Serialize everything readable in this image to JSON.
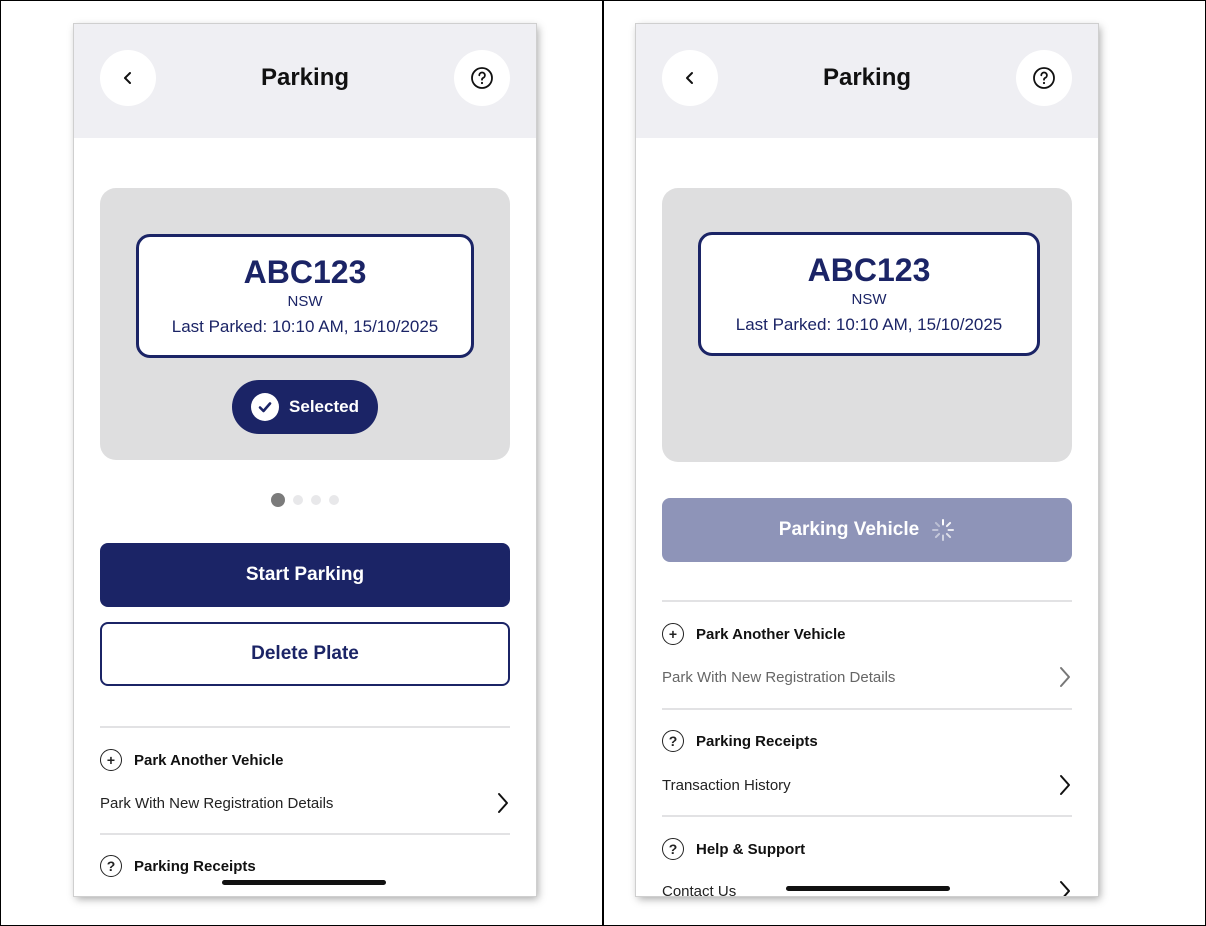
{
  "left_screen": {
    "header": {
      "title": "Parking",
      "back_icon": "chevron-left-icon",
      "help_icon": "question-circle-icon"
    },
    "vehicle_card": {
      "plate_number": "ABC123",
      "state": "NSW",
      "last_parked": "Last Parked: 10:10 AM, 15/10/2025",
      "selected_label": "Selected"
    },
    "pagination": {
      "count": 4,
      "active_index": 0
    },
    "start_parking_label": "Start Parking",
    "delete_plate_label": "Delete Plate",
    "park_another": {
      "title": "Park Another Vehicle",
      "row_label": "Park With New Registration Details"
    },
    "receipts": {
      "title": "Parking Receipts"
    }
  },
  "right_screen": {
    "header": {
      "title": "Parking",
      "back_icon": "chevron-left-icon",
      "help_icon": "question-circle-icon"
    },
    "vehicle_card": {
      "plate_number": "ABC123",
      "state": "NSW",
      "last_parked": "Last Parked: 10:10 AM, 15/10/2025"
    },
    "parking_vehicle_label": "Parking Vehicle",
    "park_another": {
      "title": "Park Another Vehicle",
      "row_label": "Park With New Registration Details"
    },
    "receipts": {
      "title": "Parking Receipts",
      "row_label": "Transaction History"
    },
    "help_support": {
      "title": "Help & Support",
      "row_label": "Contact Us"
    }
  },
  "colors": {
    "navy": "#1b2466",
    "disabled_button": "#8e94b8",
    "card_gray": "#dededf",
    "header_gray": "#efeff3"
  }
}
